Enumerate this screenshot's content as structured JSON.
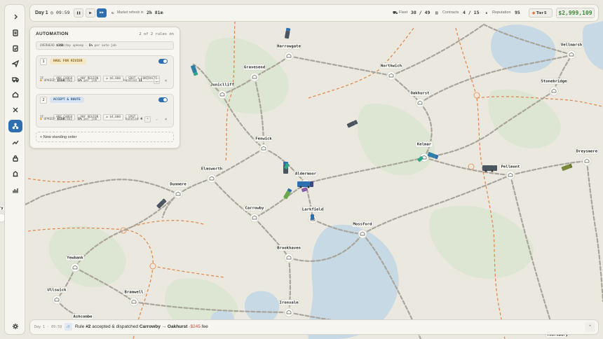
{
  "topbar": {
    "day": "Day 1",
    "time": "09:59",
    "market_label": "Market refresh in",
    "market_time": "2h 81m",
    "fleet_label": "Fleet",
    "fleet_value": "38 / 49",
    "contracts_label": "Contracts",
    "contracts_value": "4 / 15",
    "reputation_label": "Reputation",
    "reputation_value": "95",
    "tier": "Tier 5",
    "money": "$2,999,109"
  },
  "automation": {
    "title": "AUTOMATION",
    "count": "2 of 2 rules on",
    "overhead_prefix": "OVERHEAD",
    "overhead_value": "$360",
    "overhead_suffix": "/day upkeep ·",
    "overhead_pct": "5%",
    "overhead_tail": "per auto-job",
    "rules": [
      {
        "index": "1",
        "name": "HAUL FOR RIVIER",
        "if_label": "IF",
        "chips": [
          "ANY CARGO",
          "ANY REGION",
          "≥ $6,000",
          "SPOT + CONTRACTS"
        ],
        "upkeep_label": "UPKEEP",
        "upkeep_value": "$150",
        "upkeep_day": "/day ·",
        "upkeep_pct": "5%",
        "upkeep_job": "per job",
        "handled_label": "handled",
        "handled_value": "11"
      },
      {
        "index": "2",
        "name": "ACCEPT & ROUTE",
        "if_label": "IF",
        "chips": [
          "ANY CARGO",
          "ANY REGION",
          "≥ $4,000",
          "SPOT"
        ],
        "upkeep_label": "UPKEEP",
        "upkeep_value": "$150",
        "upkeep_day": "/day ·",
        "upkeep_pct": "5%",
        "upkeep_job": "per job",
        "handled_label": "handled",
        "handled_value": "4"
      }
    ],
    "new_order": "+ New standing order"
  },
  "towns": [
    {
      "name": "Harrowgate"
    },
    {
      "name": "Gravesend"
    },
    {
      "name": "Northwich"
    },
    {
      "name": "Juniclliff"
    },
    {
      "name": "Oakhurst"
    },
    {
      "name": "Vellmarsh"
    },
    {
      "name": "Stonebridge"
    },
    {
      "name": "Fenwick"
    },
    {
      "name": "Kelmar"
    },
    {
      "name": "Dreysmere"
    },
    {
      "name": "Elmsworth"
    },
    {
      "name": "Aldermoor"
    },
    {
      "name": "Pellmont"
    },
    {
      "name": "Dunmere"
    },
    {
      "name": "Carrowby"
    },
    {
      "name": "Larkfield"
    },
    {
      "name": "Mossford"
    },
    {
      "name": "Brookhaven"
    },
    {
      "name": "Yewbank"
    },
    {
      "name": "Ullswick"
    },
    {
      "name": "Bramwell"
    },
    {
      "name": "Ashcombe"
    },
    {
      "name": "Ironvale"
    },
    {
      "name": "Thornbury"
    },
    {
      "name": "bury"
    }
  ],
  "log": {
    "time": "Day 1 · 09:59",
    "prefix": "Rule",
    "rule": "#2",
    "mid": "accepted & dispatched",
    "route": "Carrowby → Oakhurst",
    "fee": "-$245",
    "fee_suffix": "fee"
  },
  "colors": {
    "accent": "#2e6fb0",
    "money": "#3a8a3a",
    "fee": "#d04a3a",
    "road": "#a8a49a",
    "border": "#e08a52",
    "water": "#c8dbe6"
  }
}
